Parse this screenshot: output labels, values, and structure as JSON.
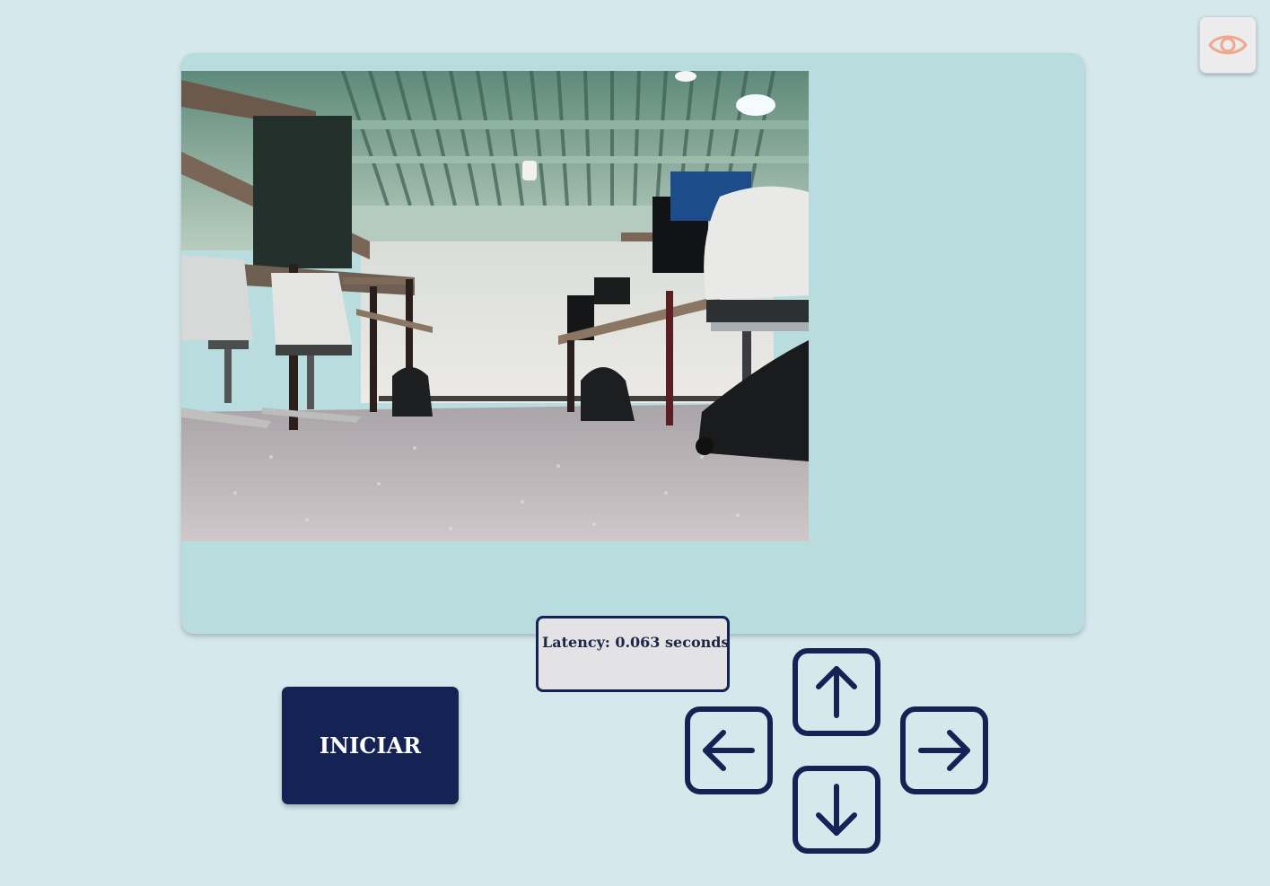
{
  "visibility_toggle": {
    "icon": "eye-icon",
    "color": "#f0a78c"
  },
  "camera": {
    "alt": "Camera feed"
  },
  "latency": {
    "text": "Latency: 0.063 seconds"
  },
  "start_button": {
    "label": "INICIAR"
  },
  "controls": {
    "up_icon": "arrow-up-icon",
    "down_icon": "arrow-down-icon",
    "left_icon": "arrow-left-icon",
    "right_icon": "arrow-right-icon",
    "color": "#152254"
  },
  "colors": {
    "background": "#d5e9ed",
    "panel": "#b9dcdf",
    "accent": "#152254"
  }
}
